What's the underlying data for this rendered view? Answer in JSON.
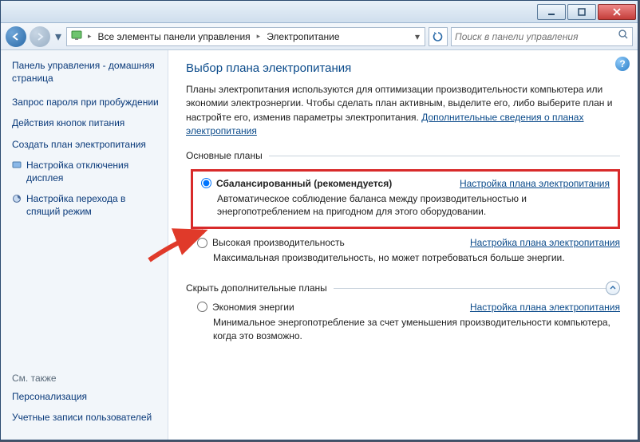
{
  "titlebar": {},
  "nav": {
    "breadcrumb_root_icon": "control-panel-icon",
    "breadcrumb_seg1": "Все элементы панели управления",
    "breadcrumb_seg2": "Электропитание",
    "search_placeholder": "Поиск в панели управления"
  },
  "sidebar": {
    "home": "Панель управления - домашняя страница",
    "links": [
      "Запрос пароля при пробуждении",
      "Действия кнопок питания",
      "Создать план электропитания",
      "Настройка отключения дисплея",
      "Настройка перехода в спящий режим"
    ],
    "see_also_label": "См. также",
    "see_also": [
      "Персонализация",
      "Учетные записи пользователей"
    ]
  },
  "main": {
    "heading": "Выбор плана электропитания",
    "intro": "Планы электропитания используются для оптимизации производительности компьютера или экономии электроэнергии. Чтобы сделать план активным, выделите его, либо выберите план и настройте его, изменив параметры электропитания. ",
    "intro_link": "Дополнительные сведения о планах электропитания",
    "primary_legend": "Основные планы",
    "plan1": {
      "label": "Сбалансированный (рекомендуется)",
      "settings": "Настройка плана электропитания",
      "desc": "Автоматическое соблюдение баланса между производительностью и энергопотреблением на пригодном для этого оборудовании."
    },
    "plan2": {
      "label": "Высокая производительность",
      "settings": "Настройка плана электропитания",
      "desc": "Максимальная производительность, но может потребоваться больше энергии."
    },
    "hide_legend": "Скрыть дополнительные планы",
    "plan3": {
      "label": "Экономия энергии",
      "settings": "Настройка плана электропитания",
      "desc": "Минимальное энергопотребление за счет уменьшения производительности компьютера, когда это возможно."
    }
  }
}
